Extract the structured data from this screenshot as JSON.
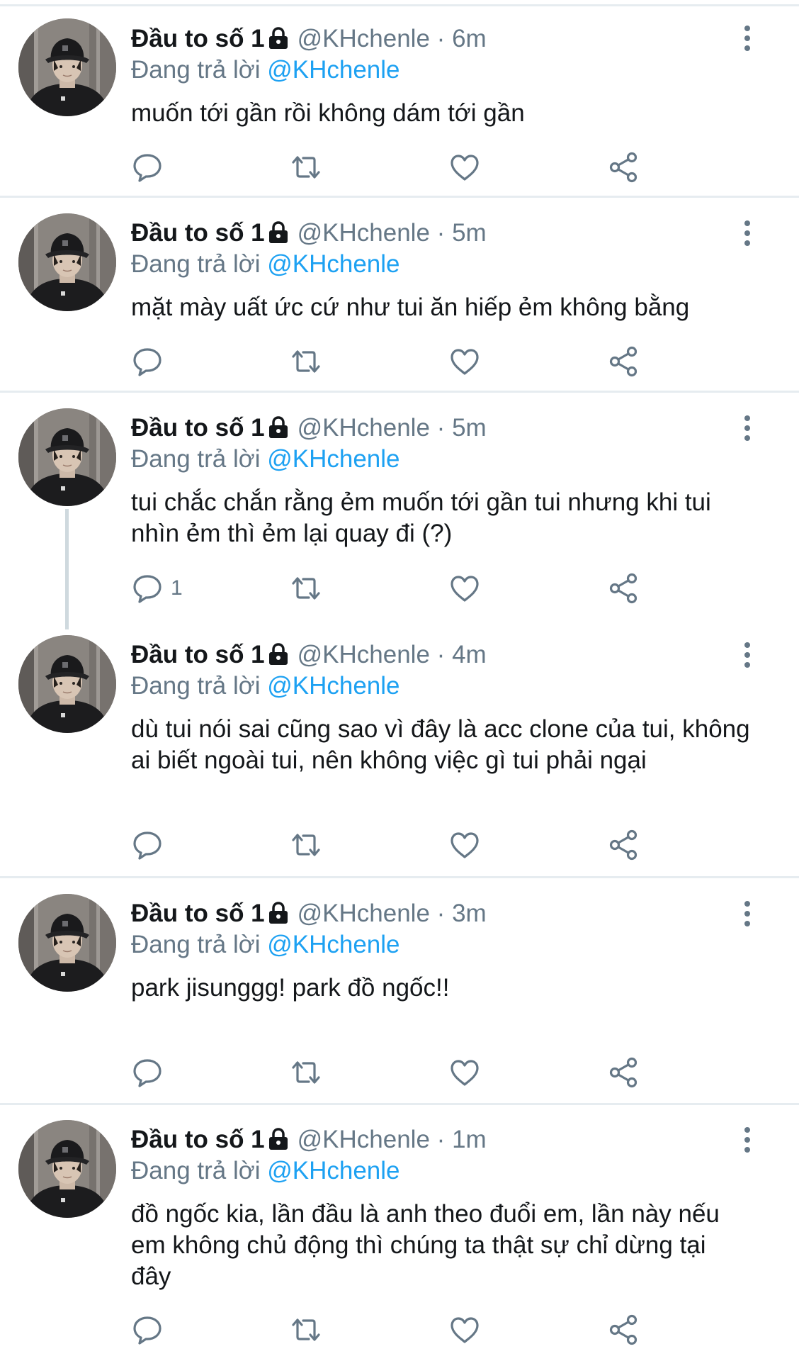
{
  "tweets": [
    {
      "author": "Đầu to số 1",
      "handle": "@KHchenle",
      "separator": "·",
      "time": "6m",
      "replying_label": "Đang trả lời ",
      "replying_to": "@KHchenle",
      "text": "muốn tới gần rồi không dám tới gần",
      "reply_count": ""
    },
    {
      "author": "Đầu to số 1",
      "handle": "@KHchenle",
      "separator": "·",
      "time": "5m",
      "replying_label": "Đang trả lời ",
      "replying_to": "@KHchenle",
      "text": "mặt mày uất ức cứ như tui ăn hiếp ẻm không bằng",
      "reply_count": ""
    },
    {
      "author": "Đầu to số 1",
      "handle": "@KHchenle",
      "separator": "·",
      "time": "5m",
      "replying_label": "Đang trả lời ",
      "replying_to": "@KHchenle",
      "text": "tui chắc chắn rằng ẻm muốn tới gần tui nhưng khi tui nhìn ẻm thì ẻm lại quay đi (?)",
      "reply_count": "1"
    },
    {
      "author": "Đầu to số 1",
      "handle": "@KHchenle",
      "separator": "·",
      "time": "4m",
      "replying_label": "Đang trả lời ",
      "replying_to": "@KHchenle",
      "text": "dù tui nói sai cũng sao vì đây là acc clone của tui, không ai biết ngoài tui, nên không việc gì tui phải ngại",
      "reply_count": ""
    },
    {
      "author": "Đầu to số 1",
      "handle": "@KHchenle",
      "separator": "·",
      "time": "3m",
      "replying_label": "Đang trả lời ",
      "replying_to": "@KHchenle",
      "text": "park jisunggg! park đồ ngốc!!",
      "reply_count": ""
    },
    {
      "author": "Đầu to số 1",
      "handle": "@KHchenle",
      "separator": "·",
      "time": "1m",
      "replying_label": "Đang trả lời ",
      "replying_to": "@KHchenle",
      "text": "đồ ngốc kia, lần đầu là anh theo đuổi em, lần này nếu em không chủ động thì chúng ta thật sự chỉ dừng tại đây",
      "reply_count": ""
    }
  ],
  "icons": {
    "lock": "lock-icon",
    "more": "more-vertical-icon",
    "reply": "reply-icon",
    "retweet": "retweet-icon",
    "like": "heart-icon",
    "share": "share-icon"
  },
  "colors": {
    "text": "#14171a",
    "secondary": "#657786",
    "link": "#1da1f2",
    "divider": "#e6ecf0",
    "thread_line": "#cfd9de"
  }
}
